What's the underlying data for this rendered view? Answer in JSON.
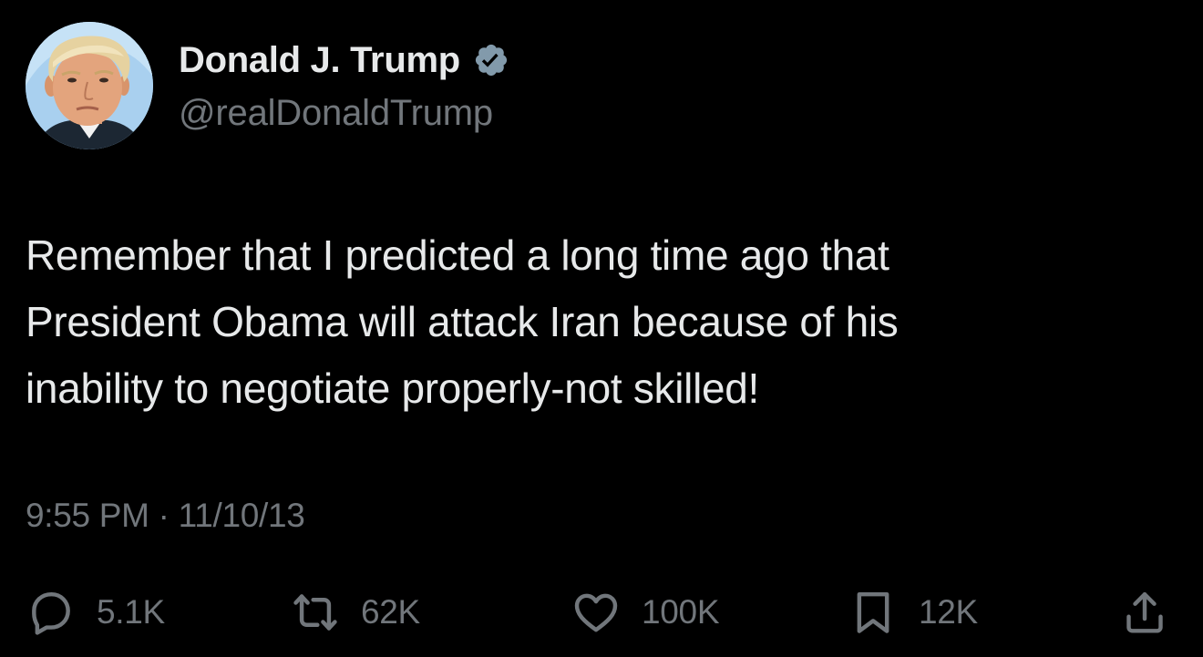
{
  "author": {
    "display_name": "Donald J. Trump",
    "handle": "@realDonaldTrump",
    "verified_icon": "verified-badge-icon",
    "avatar": "profile-photo"
  },
  "tweet": {
    "lines": [
      "Remember that I predicted a long time ago that",
      "President Obama will attack Iran because of his",
      "inability to negotiate properly-not skilled!"
    ],
    "timestamp": "9:55 PM · 11/10/13"
  },
  "actions": {
    "reply": {
      "icon": "reply-icon",
      "count": "5.1K"
    },
    "retweet": {
      "icon": "retweet-icon",
      "count": "62K"
    },
    "like": {
      "icon": "heart-icon",
      "count": "100K"
    },
    "bookmark": {
      "icon": "bookmark-icon",
      "count": "12K"
    },
    "share": {
      "icon": "share-icon"
    }
  },
  "colors": {
    "background": "#000000",
    "primary_text": "#e7e9ea",
    "secondary_text": "#71767b",
    "verified_badge": "#829aab"
  }
}
